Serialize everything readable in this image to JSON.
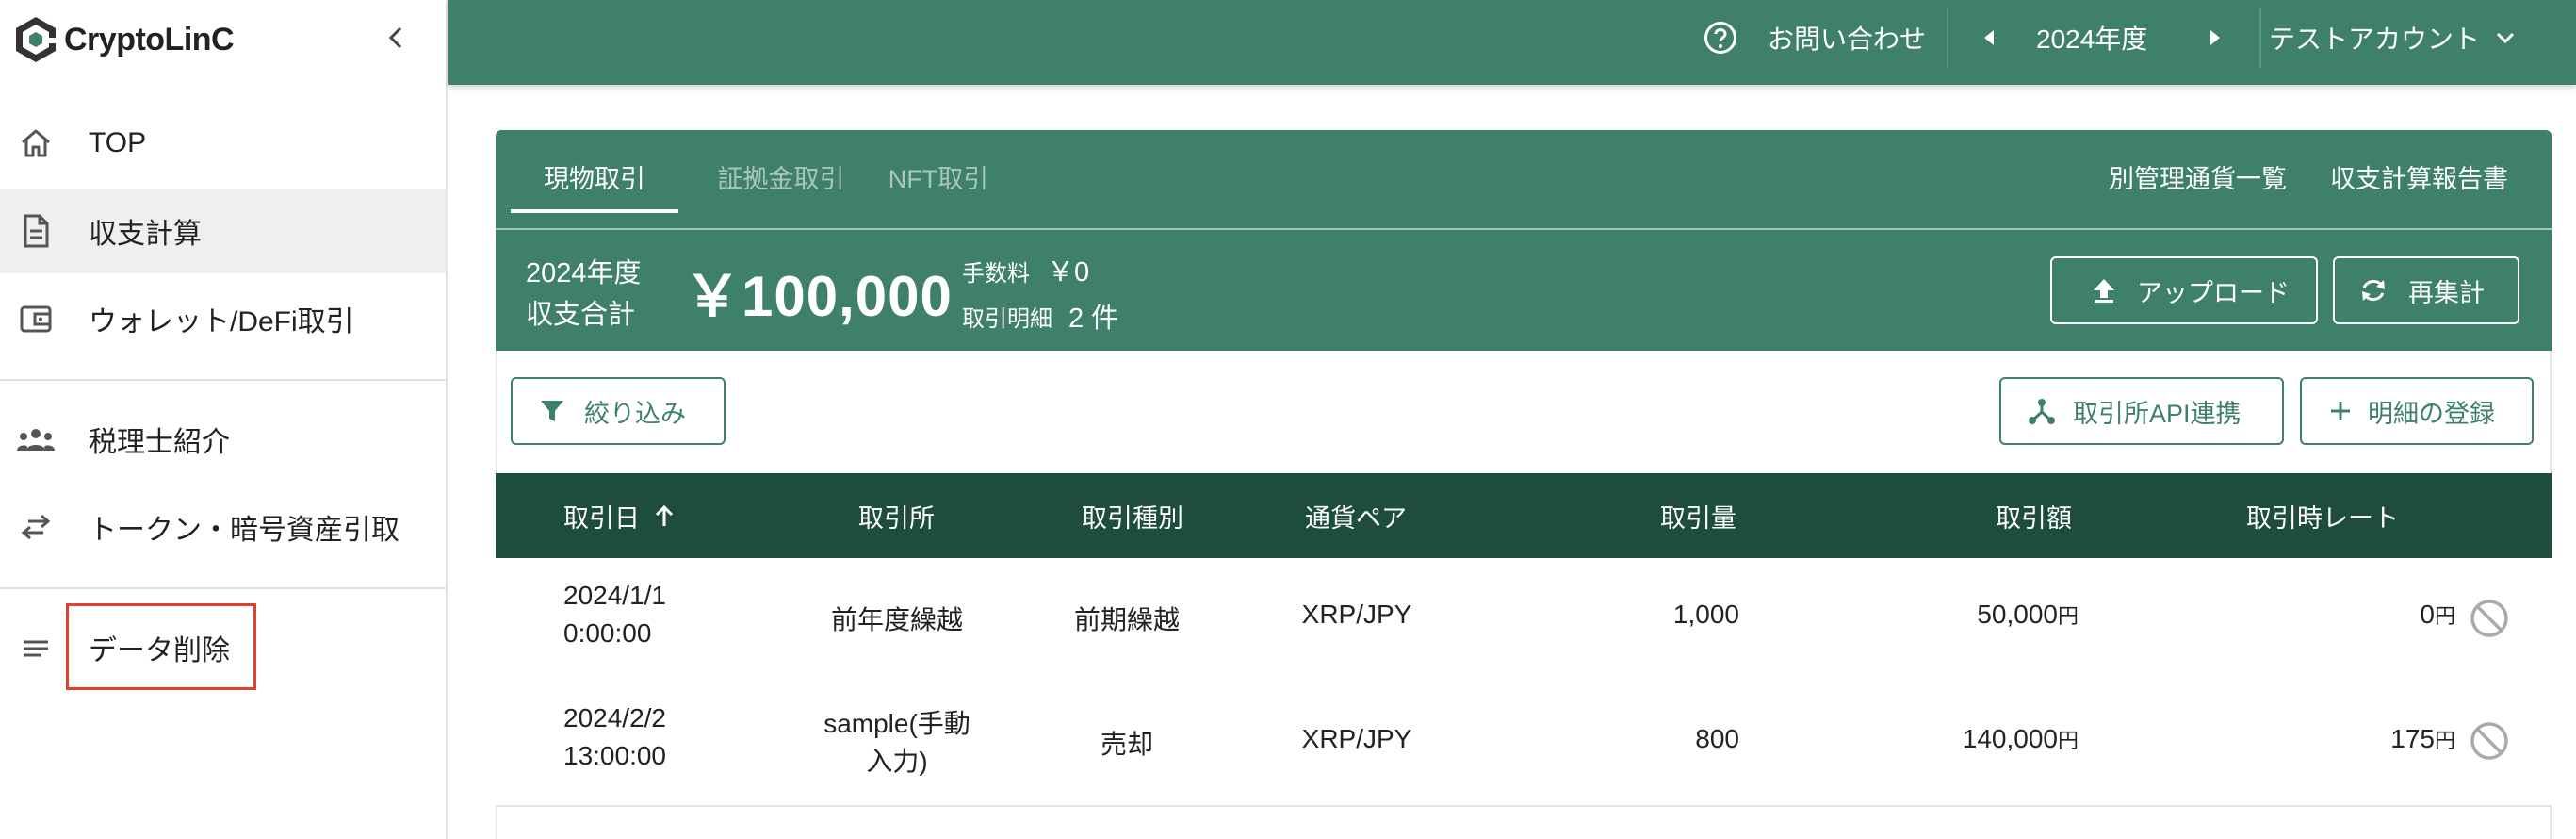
{
  "sidebar": {
    "brand": "CryptoLinC",
    "items": [
      {
        "label": "TOP",
        "icon": "home-icon"
      },
      {
        "label": "収支計算",
        "icon": "document-icon"
      },
      {
        "label": "ウォレット/DeFi取引",
        "icon": "wallet-icon"
      },
      {
        "label": "税理士紹介",
        "icon": "people-icon"
      },
      {
        "label": "トークン・暗号資産引取",
        "icon": "swap-icon"
      },
      {
        "label": "データ削除",
        "icon": "lines-icon"
      }
    ],
    "active_index": 1,
    "highlight_color": "#e0402e"
  },
  "header": {
    "help_icon": "help-icon",
    "contact": "お問い合わせ",
    "year": "2024年度",
    "account": "テストアカウント",
    "bg_color": "#3e8068"
  },
  "tabs": [
    {
      "label": "現物取引",
      "active": true
    },
    {
      "label": "証拠金取引",
      "active": false
    },
    {
      "label": "NFT取引",
      "active": false
    }
  ],
  "links": {
    "separate_currency": "別管理通貨一覧",
    "report": "収支計算報告書"
  },
  "summary": {
    "year_label": "2024年度",
    "total_label": "収支合計",
    "total": "￥100,000",
    "fee_label": "手数料",
    "fee": "￥0",
    "count_label": "取引明細",
    "count": "2 件"
  },
  "buttons": {
    "upload": "アップロード",
    "recalc": "再集計",
    "filter": "絞り込み",
    "api": "取引所API連携",
    "add": "明細の登録"
  },
  "table": {
    "headers": [
      "取引日",
      "取引所",
      "取引種別",
      "通貨ペア",
      "取引量",
      "取引額",
      "取引時レート"
    ],
    "sort_icon": "arrow-up-icon",
    "yen": "円",
    "rows": [
      {
        "date": "2024/1/1",
        "time": "0:00:00",
        "exchange_1": "前年度繰越",
        "exchange_2": "",
        "type": "前期繰越",
        "pair": "XRP/JPY",
        "amount": "1,000",
        "value": "50,000",
        "rate": "0"
      },
      {
        "date": "2024/2/2",
        "time": "13:00:00",
        "exchange_1": "sample(手動",
        "exchange_2": "入力)",
        "type": "売却",
        "pair": "XRP/JPY",
        "amount": "800",
        "value": "140,000",
        "rate": "175"
      }
    ]
  },
  "colors": {
    "primary": "#3e8068",
    "table_header": "#1e4d3b"
  }
}
